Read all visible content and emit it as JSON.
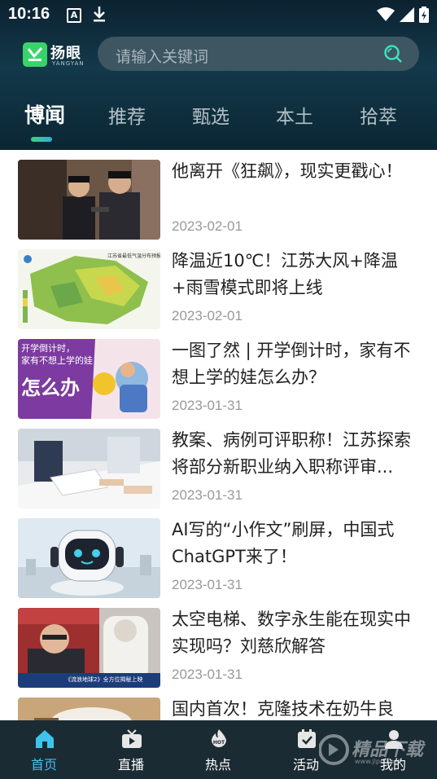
{
  "status_bar": {
    "time": "10:16",
    "a_icon": "A"
  },
  "header": {
    "logo_text": "扬眼",
    "logo_sub": "YANGYAN",
    "search_placeholder": "请输入关键词"
  },
  "tabs": [
    {
      "label": "博闻",
      "active": true
    },
    {
      "label": "推荐",
      "active": false
    },
    {
      "label": "甄选",
      "active": false
    },
    {
      "label": "本土",
      "active": false
    },
    {
      "label": "拾萃",
      "active": false
    }
  ],
  "news": [
    {
      "title": "他离开《狂飙》，现实更戳心！",
      "date": "2023-02-01"
    },
    {
      "title": "降温近10℃！江苏大风+降温+雨雪模式即将上线",
      "date": "2023-02-01",
      "thumb_caption": "江苏省最低气温分布预报"
    },
    {
      "title": "一图了然 | 开学倒计时，家有不想上学的娃怎么办？",
      "date": "2023-01-31",
      "thumb_line1": "开学倒计时，",
      "thumb_line2": "家有不想上学的娃",
      "thumb_line3": "怎么办"
    },
    {
      "title": "教案、病例可评职称！江苏探索将部分新职业纳入职称评审...",
      "date": "2023-01-31"
    },
    {
      "title": "AI写的“小作文”刷屏，中国式ChatGPT来了！",
      "date": "2023-01-31"
    },
    {
      "title": "太空电梯、数字永生能在现实中实现吗？刘慈欣解答",
      "date": "2023-01-31",
      "thumb_caption": "《流浪地球2》全方位揭秘上映"
    },
    {
      "title": "国内首次！克隆技术在奶牛良",
      "date": ""
    }
  ],
  "bottom_nav": [
    {
      "label": "首页",
      "icon": "home-icon",
      "active": true
    },
    {
      "label": "直播",
      "icon": "tv-icon",
      "active": false
    },
    {
      "label": "热点",
      "icon": "hot-icon",
      "active": false
    },
    {
      "label": "活动",
      "icon": "activity-icon",
      "active": false
    },
    {
      "label": "我的",
      "icon": "user-icon",
      "active": false
    }
  ],
  "watermark": {
    "text": "精品下载",
    "url": "www.jlpcn.net"
  },
  "colors": {
    "accent": "#3fc3ee",
    "brand_green": "#39d36b",
    "header_bg": "#13394a",
    "tabbar_bg": "#1b2b33"
  }
}
